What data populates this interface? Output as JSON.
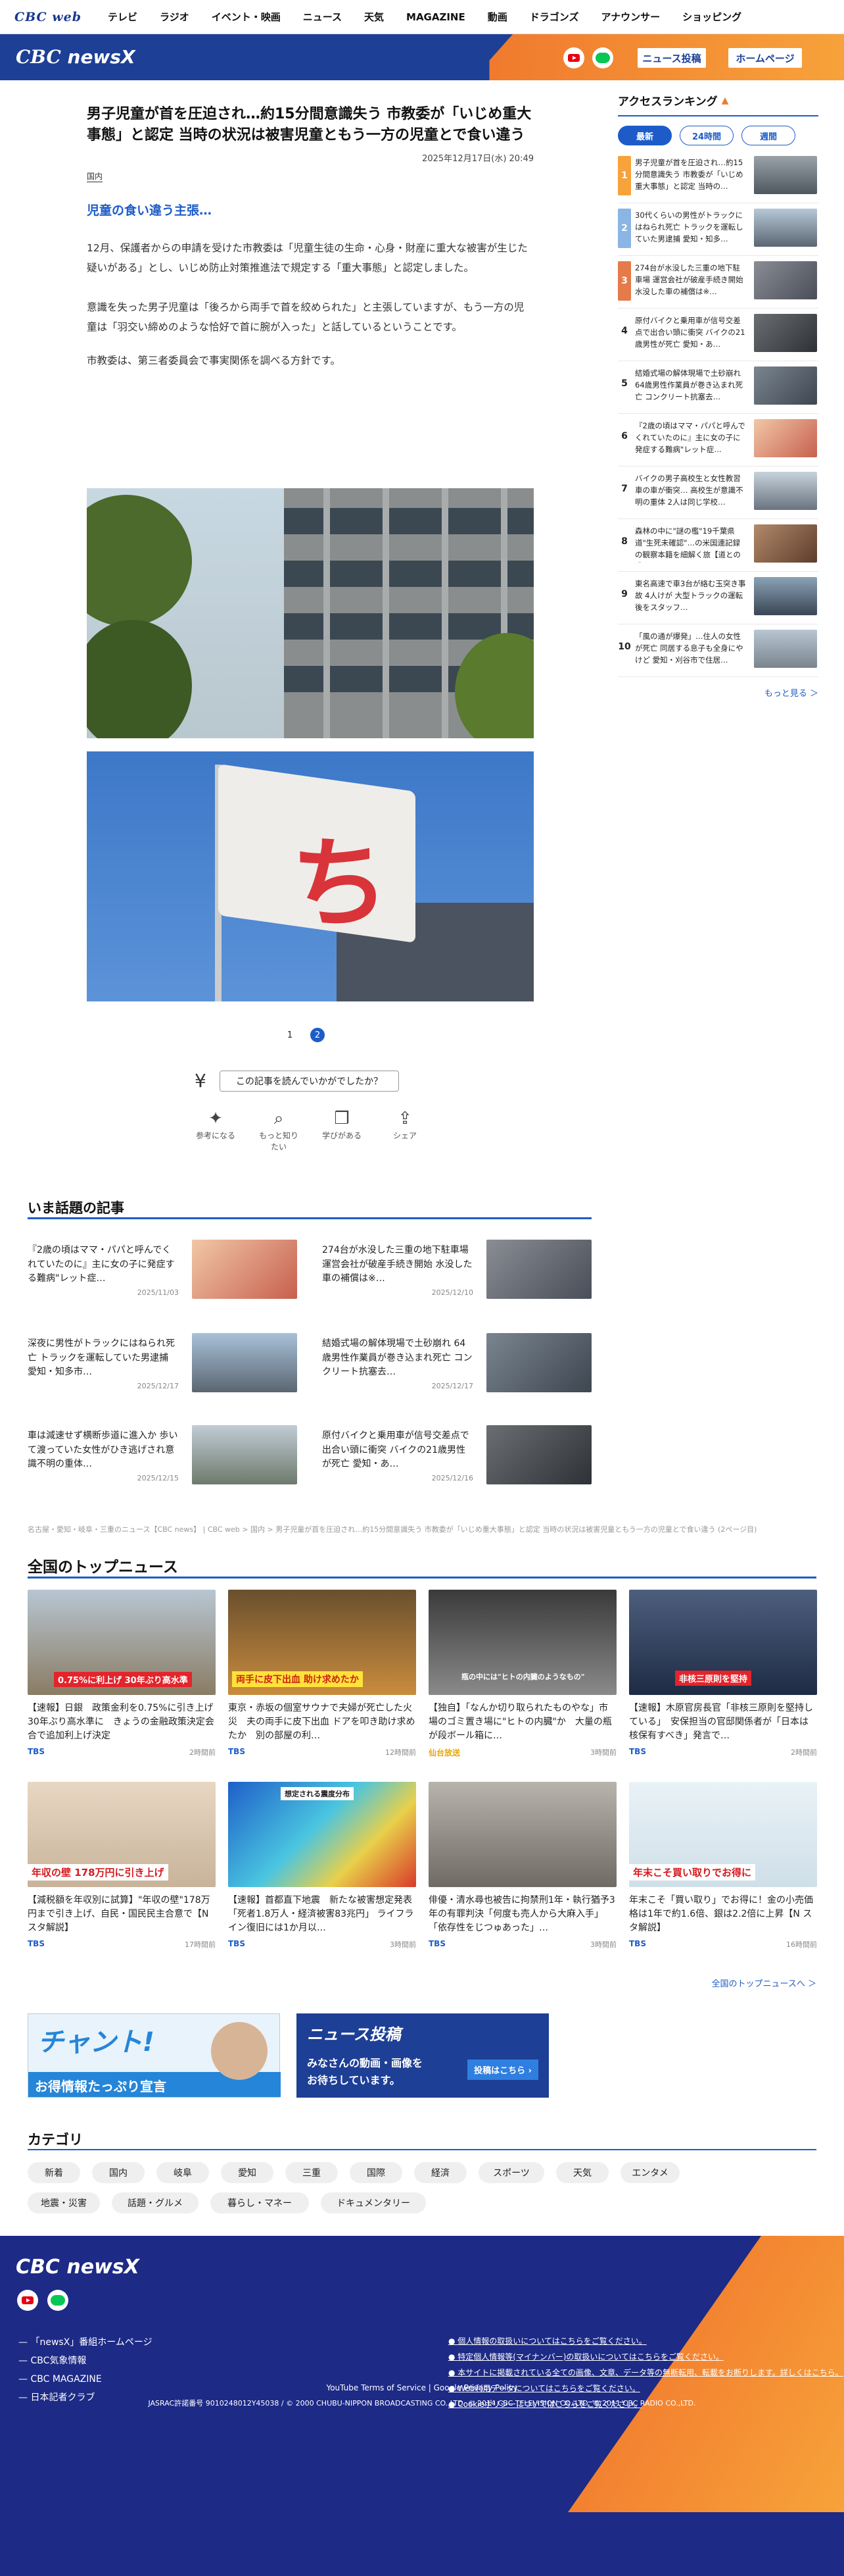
{
  "top_nav": {
    "brand": "CBC web",
    "items": [
      "テレビ",
      "ラジオ",
      "イベント・映画",
      "ニュース",
      "天気",
      "MAGAZINE",
      "動画",
      "ドラゴンズ",
      "アナウンサー",
      "ショッピング"
    ]
  },
  "header": {
    "logo_main": "CBC",
    "logo_sub": "newsX",
    "btn_post": "ニュース投稿",
    "btn_home": "ホームページ"
  },
  "article": {
    "title": "男子児童が首を圧迫され…約15分間意識失う 市教委が「いじめ重大事態」と認定 当時の状況は被害児童ともう一方の児童とで食い違う",
    "date": "2025年12月17日(水) 20:49",
    "category": "国内",
    "subheading": "児童の食い違う主張…",
    "paragraphs": [
      "12月、保護者からの申請を受けた市教委は「児童生徒の生命・心身・財産に重大な被害が生じた疑いがある」とし、いじめ防止対策推進法で規定する「重大事態」と認定しました。",
      "意識を失った男子児童は「後ろから両手で首を絞められた」と主張していますが、もう一方の児童は「羽交い締めのような恰好で首に腕が入った」と話しているということです。",
      "市教委は、第三者委員会で事実関係を調べる方針です。"
    ]
  },
  "pager": {
    "p1": "1",
    "p2": "2"
  },
  "survey": {
    "question": "この記事を読んでいかがでしたか？",
    "reactions": [
      "参考になる",
      "もっと知りたい",
      "学びがある",
      "シェア"
    ]
  },
  "topics": {
    "heading": "いま話題の記事",
    "items": [
      {
        "title": "『2歳の頃はママ・パパと呼んでくれていたのに』主に女の子に発症する難病\"レット症…",
        "date": "2025/11/03"
      },
      {
        "title": "274台が水没した三重の地下駐車場 運営会社が破産手続き開始 水没した車の補償は※…",
        "date": "2025/12/10"
      },
      {
        "title": "深夜に男性がトラックにはねられ死亡 トラックを運転していた男逮捕　愛知・知多市…",
        "date": "2025/12/17"
      },
      {
        "title": "結婚式場の解体現場で土砂崩れ 64歳男性作業員が巻き込まれ死亡 コンクリート抗塞去…",
        "date": "2025/12/17"
      },
      {
        "title": "車は減速せず横断歩道に進入か 歩いて渡っていた女性がひき逃げされ意識不明の重体…",
        "date": "2025/12/15"
      },
      {
        "title": "原付バイクと乗用車が信号交差点で出合い頭に衝突 バイクの21歳男性が死亡 愛知・あ…",
        "date": "2025/12/16"
      }
    ]
  },
  "breadcrumb": "名古屋・愛知・岐阜・三重のニュース【CBC news】 | CBC web > 国内 > 男子児童が首を圧迫され…約15分間意識失う 市教委が「いじめ重大事態」と認定 当時の状況は被害児童ともう一方の児童とで食い違う (2ページ目)",
  "national": {
    "heading": "全国のトップニュース",
    "more": "全国のトップニュースへ ＞",
    "items": [
      {
        "title": "【速報】日銀　政策金利を0.75%に引き上げ　30年ぶり高水準に　きょうの金融政策決定会合で追加利上げ決定",
        "src": "TBS",
        "ago": "2時間前",
        "cap": "0.75%に利上げ 30年ぶり高水準"
      },
      {
        "title": "東京・赤坂の個室サウナで夫婦が死亡した火災　夫の両手に皮下出血 ドアを叩き助け求めたか　別の部屋の利…",
        "src": "TBS",
        "ago": "12時間前",
        "cap": "両手に皮下出血 助け求めたか"
      },
      {
        "title": "【独自】「なんか切り取られたものやな」市場のゴミ置き場に\"ヒトの内臓\"か　大量の瓶が段ボール箱に…",
        "src": "仙台放送",
        "ago": "3時間前",
        "cap": "瓶の中には\"ヒトの内臓のようなもの\""
      },
      {
        "title": "【速報】木原官房長官「非核三原則を堅持している」　安保担当の官邸関係者が「日本は核保有すべき」発言で…",
        "src": "TBS",
        "ago": "2時間前",
        "cap": "非核三原則を堅持"
      },
      {
        "title": "【減税額を年収別に試算】\"年収の壁\"178万円まで引き上げ、自民・国民民主合意で【N スタ解説】",
        "src": "TBS",
        "ago": "17時間前",
        "cap": "年収の壁 178万円に引き上げ"
      },
      {
        "title": "【速報】首都直下地震　新たな被害想定発表「死者1.8万人・経済被害83兆円」 ライフライン復旧には1か月以…",
        "src": "TBS",
        "ago": "3時間前",
        "cap": "想定される震度分布"
      },
      {
        "title": "俳優・清水尋也被告に拘禁刑1年・執行猶予3年の有罪判決「何度も売人から大麻入手」「依存性をじつゅあった」…",
        "src": "TBS",
        "ago": "3時間前",
        "cap": ""
      },
      {
        "title": "年末こそ「買い取り」でお得に！金の小売価格は1年で約1.6倍、銀は2.2倍に上昇【N スタ解説】",
        "src": "TBS",
        "ago": "16時間前",
        "cap": "年末こそ買い取りでお得に"
      }
    ]
  },
  "banners": {
    "chant_title": "チャント!",
    "chant_sub": "お得情報たっぷり宣言",
    "post_title": "ニュース投稿",
    "post_sub1": "みなさんの動画・画像を",
    "post_sub2": "お待ちしています。",
    "post_btn": "投稿はこちら ›"
  },
  "categories": {
    "heading": "カテゴリ",
    "row1": [
      "新着",
      "国内",
      "岐阜",
      "愛知",
      "三重",
      "国際",
      "経済",
      "スポーツ",
      "天気",
      "エンタメ"
    ],
    "row2": [
      "地震・災害",
      "話題・グルメ",
      "暮らし・マネー",
      "ドキュメンタリー"
    ]
  },
  "sidebar": {
    "heading": "アクセスランキング",
    "tabs": [
      "最新",
      "24時間",
      "週間"
    ],
    "more": "もっと見る ＞",
    "items": [
      "男子児童が首を圧迫され…約15分間意識失う 市教委が「いじめ重大事態」と認定 当時の…",
      "30代くらいの男性がトラックにはねられ死亡 トラックを運転していた男逮捕 愛知・知多…",
      "274台が水没した三重の地下駐車場 運営会社が破産手続き開始 水没した車の補償は※…",
      "原付バイクと乗用車が信号交差点で出合い頭に衝突 バイクの21歳男性が死亡 愛知・あ…",
      "結婚式場の解体現場で土砂崩れ 64歳男性作業員が巻き込まれ死亡 コンクリート抗塞去…",
      "『2歳の頃はママ・パパと呼んでくれていたのに』主に女の子に発症する難病\"レット症…",
      "バイクの男子高校生と女性教習車の車が衝突… 高校生が意識不明の重体 2人は同じ学校…",
      "森林の中に\"謎の檻\"19千葉県道\"生死未確認\"…の米国連記録の観察本籍を細解く旅【道との遭…",
      "東名高速で車3台が絡む玉突き事故 4人けが 大型トラックの運転後をスタッフ…",
      "「風の通が爆発」…住人の女性が死亡 同居する息子も全身にやけど 愛知・刈谷市で住居…"
    ]
  },
  "footer": {
    "logo_main": "CBC",
    "logo_sub": "newsX",
    "links": [
      "「newsX」番組ホームページ",
      "CBC気象情報",
      "CBC MAGAZINE",
      "日本記者クラブ"
    ],
    "policies": [
      "個人情報の取扱いについてはこちらをご覧ください。",
      "特定個人情報等(マイナンバー)の取扱いについてはこちらをご覧ください。",
      "本サイトに掲載されている全ての画像、文章、データ等の無断転用、転載をお断りします。詳しくはこちら。",
      "Web利用データについてはこちらをご覧ください。",
      "Cookieポリシーについてはこちらをご覧ください。"
    ],
    "yt": "YouTube Terms of Service | Google Privacy Policy",
    "copyright": "JASRAC許諾番号 9010248012Y45038 / © 2000 CHUBU-NIPPON BROADCASTING CO.,LTD. © 2014 CBC TELEVISION CO.,LTD. © 2011 CBC RADIO CO.,LTD."
  },
  "colors": {
    "brand_blue": "#1d3f95",
    "accent_blue": "#1d5cc8",
    "orange": "#f7a23a"
  }
}
